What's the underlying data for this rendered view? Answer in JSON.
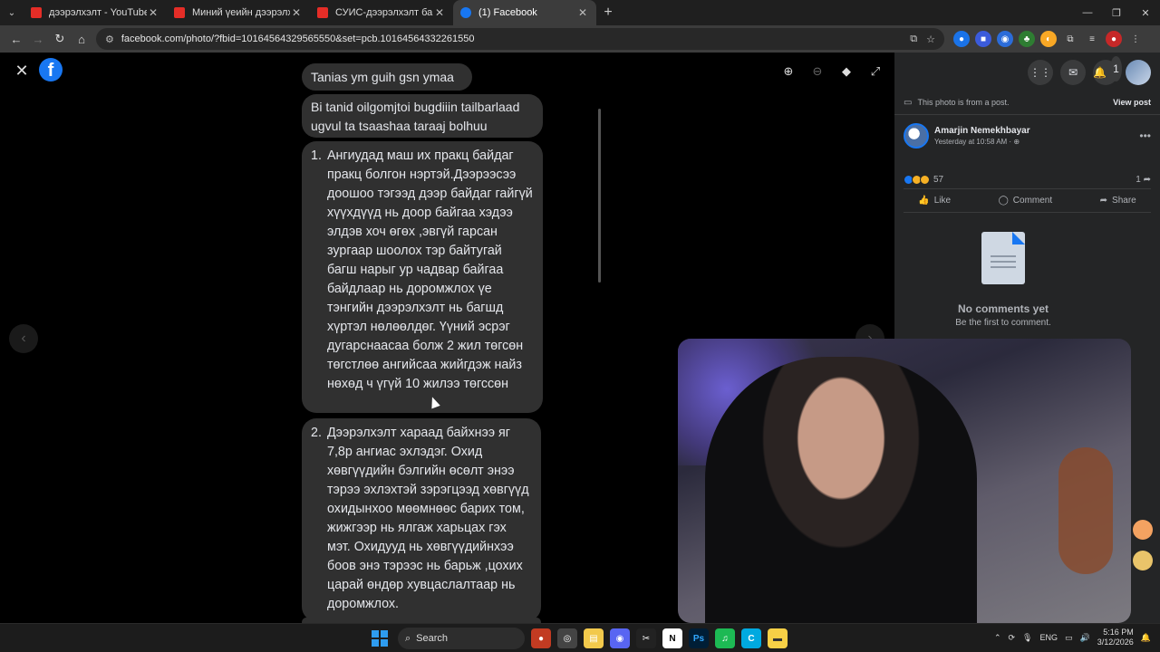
{
  "browser": {
    "tabs": [
      {
        "title": "дээрэлхэлт - YouTube",
        "icon": "youtube-icon",
        "active": false
      },
      {
        "title": "Миний үеийн дээрэлхэлт | АРА...",
        "icon": "youtube-icon",
        "active": false
      },
      {
        "title": "СУИС-дээрэлхэлт байх ёстой юм...",
        "icon": "youtube-icon",
        "active": false
      },
      {
        "title": "(1) Facebook",
        "icon": "facebook-icon",
        "active": true
      }
    ],
    "url": "facebook.com/photo/?fbid=10164564329565550&set=pcb.10164564332261550"
  },
  "chat": {
    "msg1": "Tanias ym guih gsn ymaa",
    "msg2": "Bi tanid oilgomjtoi bugdiiin tailbarlaad ugvul ta tsaashaa taraaj bolhuu",
    "item1_num": "1.",
    "item1_text": "Ангиудад маш их пракц байдаг пракц болгон нэртэй.Дээрээсээ доошоо тэгээд дээр байдаг гайгүй хүүхдүүд нь доор байгаа хэдээ элдэв хоч өгөх ,эвгүй гарсан зургаар шоолох тэр байтугай багш нарыг ур чадвар байгаа байдлаар нь доромжлох үе тэнгийн дээрэлхэлт нь багшд хүртэл нөлөөлдөг. Үүний эсрэг дугарснаасаа болж 2 жил төгсөн төгстлөө ангийсаа жийгдэж найз нөхөд ч үгүй 10 жилээ төгссөн",
    "item2_num": "2.",
    "item2_text": "Дээрэлхэлт хараад байхнээ яг 7,8р ангиас эхлэдэг. Охид хөвгүүдийн бэлгийн өсөлт энээ тэрээ эхлэхтэй зэрэгцээд хөвгүүд охидынхоо мөөмнөөс барих том, жижгээр нь ялгаж харьцах гэх мэт. Охидууд нь хөвгүүдийнхээ боов энэ тэрээс нь барьж ,цохих царай өндөр хувцаслалтаар нь доромжлох."
  },
  "panel": {
    "post_note": "This photo is from a post.",
    "view_post": "View post",
    "author_name": "Amarjin Nemekhbayar",
    "author_time": "Yesterday at 10:58 AM · ",
    "reaction_count": "57",
    "share_count": "1",
    "like": "Like",
    "comment": "Comment",
    "share": "Share",
    "no_comments": "No comments yet",
    "first_comment": "Be the first to comment.",
    "notif_badge": "1"
  },
  "taskbar": {
    "search": "Search",
    "lang": "ENG",
    "time": "5:16 PM",
    "date": "3/12/2026"
  },
  "colors": {
    "fb_blue": "#1877f2",
    "bubble": "#303030",
    "panel_bg": "#242526"
  }
}
